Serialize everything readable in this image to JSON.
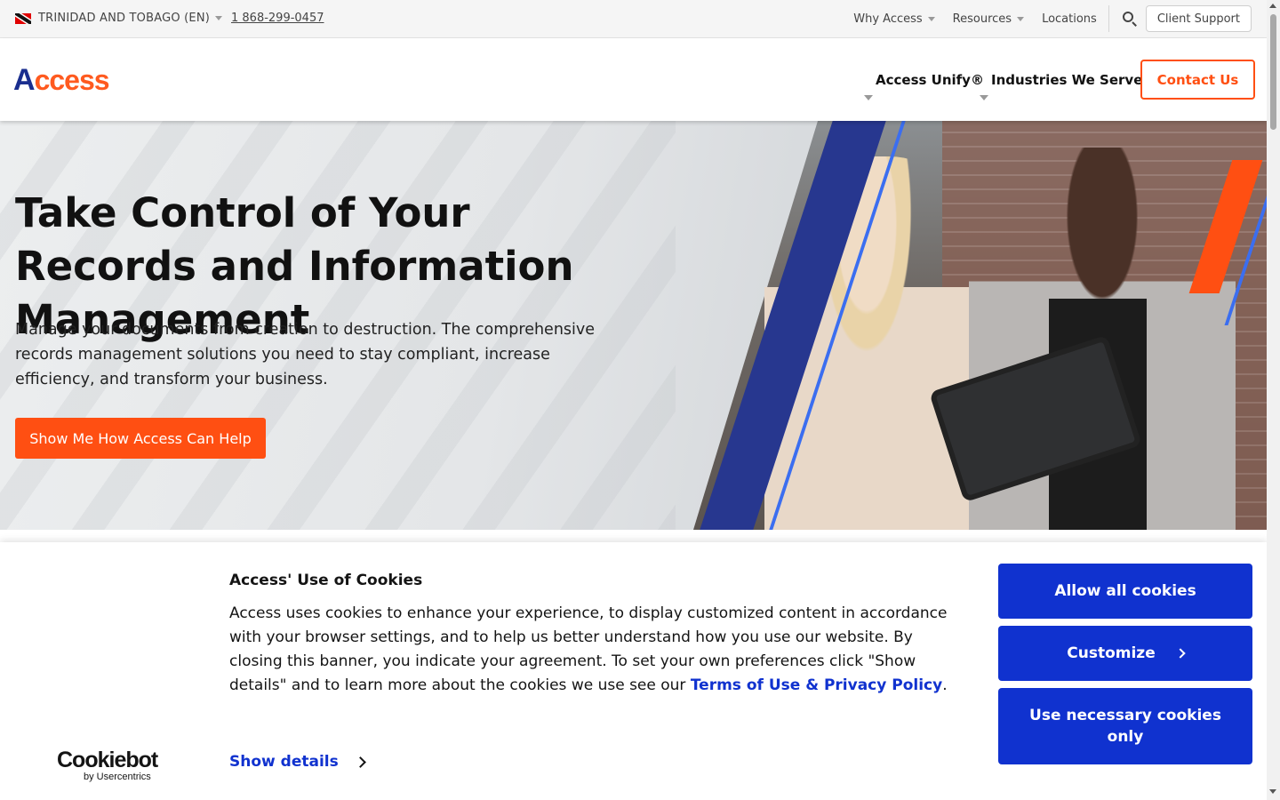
{
  "utility_bar": {
    "locale": "TRINIDAD AND TOBAGO (EN)",
    "phone": "1 868-299-0457",
    "links": [
      {
        "label": "Why Access",
        "has_dropdown": true
      },
      {
        "label": "Resources",
        "has_dropdown": true
      },
      {
        "label": "Locations",
        "has_dropdown": false
      }
    ],
    "client_support": "Client Support"
  },
  "header": {
    "logo_first": "A",
    "logo_rest": "ccess",
    "nav": [
      "Access Unify®",
      "Industries We Serve"
    ],
    "contact": "Contact Us"
  },
  "hero": {
    "title": "Take Control of Your Records and Information Management",
    "subtitle": "Manage your documents from creation to destruction. The comprehensive records management solutions you need to stay compliant, increase efficiency, and transform your business.",
    "cta": "Show Me How Access Can Help"
  },
  "cookie_banner": {
    "logo_main": "Cookiebot",
    "logo_by": "by Usercentrics",
    "title": "Access' Use of Cookies",
    "text": "Access uses cookies to enhance your experience, to display customized content in accordance with your browser settings, and to help us better understand how you use our website. By closing this banner, you indicate your agreement. To set your own preferences click \"Show details\" and to learn more about the cookies we use see our ",
    "link": "Terms of Use & Privacy Policy",
    "text_end": ".",
    "show_details": "Show details",
    "allow_all": "Allow all cookies",
    "customize": "Customize",
    "necessary_only": "Use necessary cookies only"
  },
  "colors": {
    "brand_orange": "#ff4f12",
    "brand_navy": "#1a2e8f",
    "cookie_blue": "#1032cf"
  }
}
